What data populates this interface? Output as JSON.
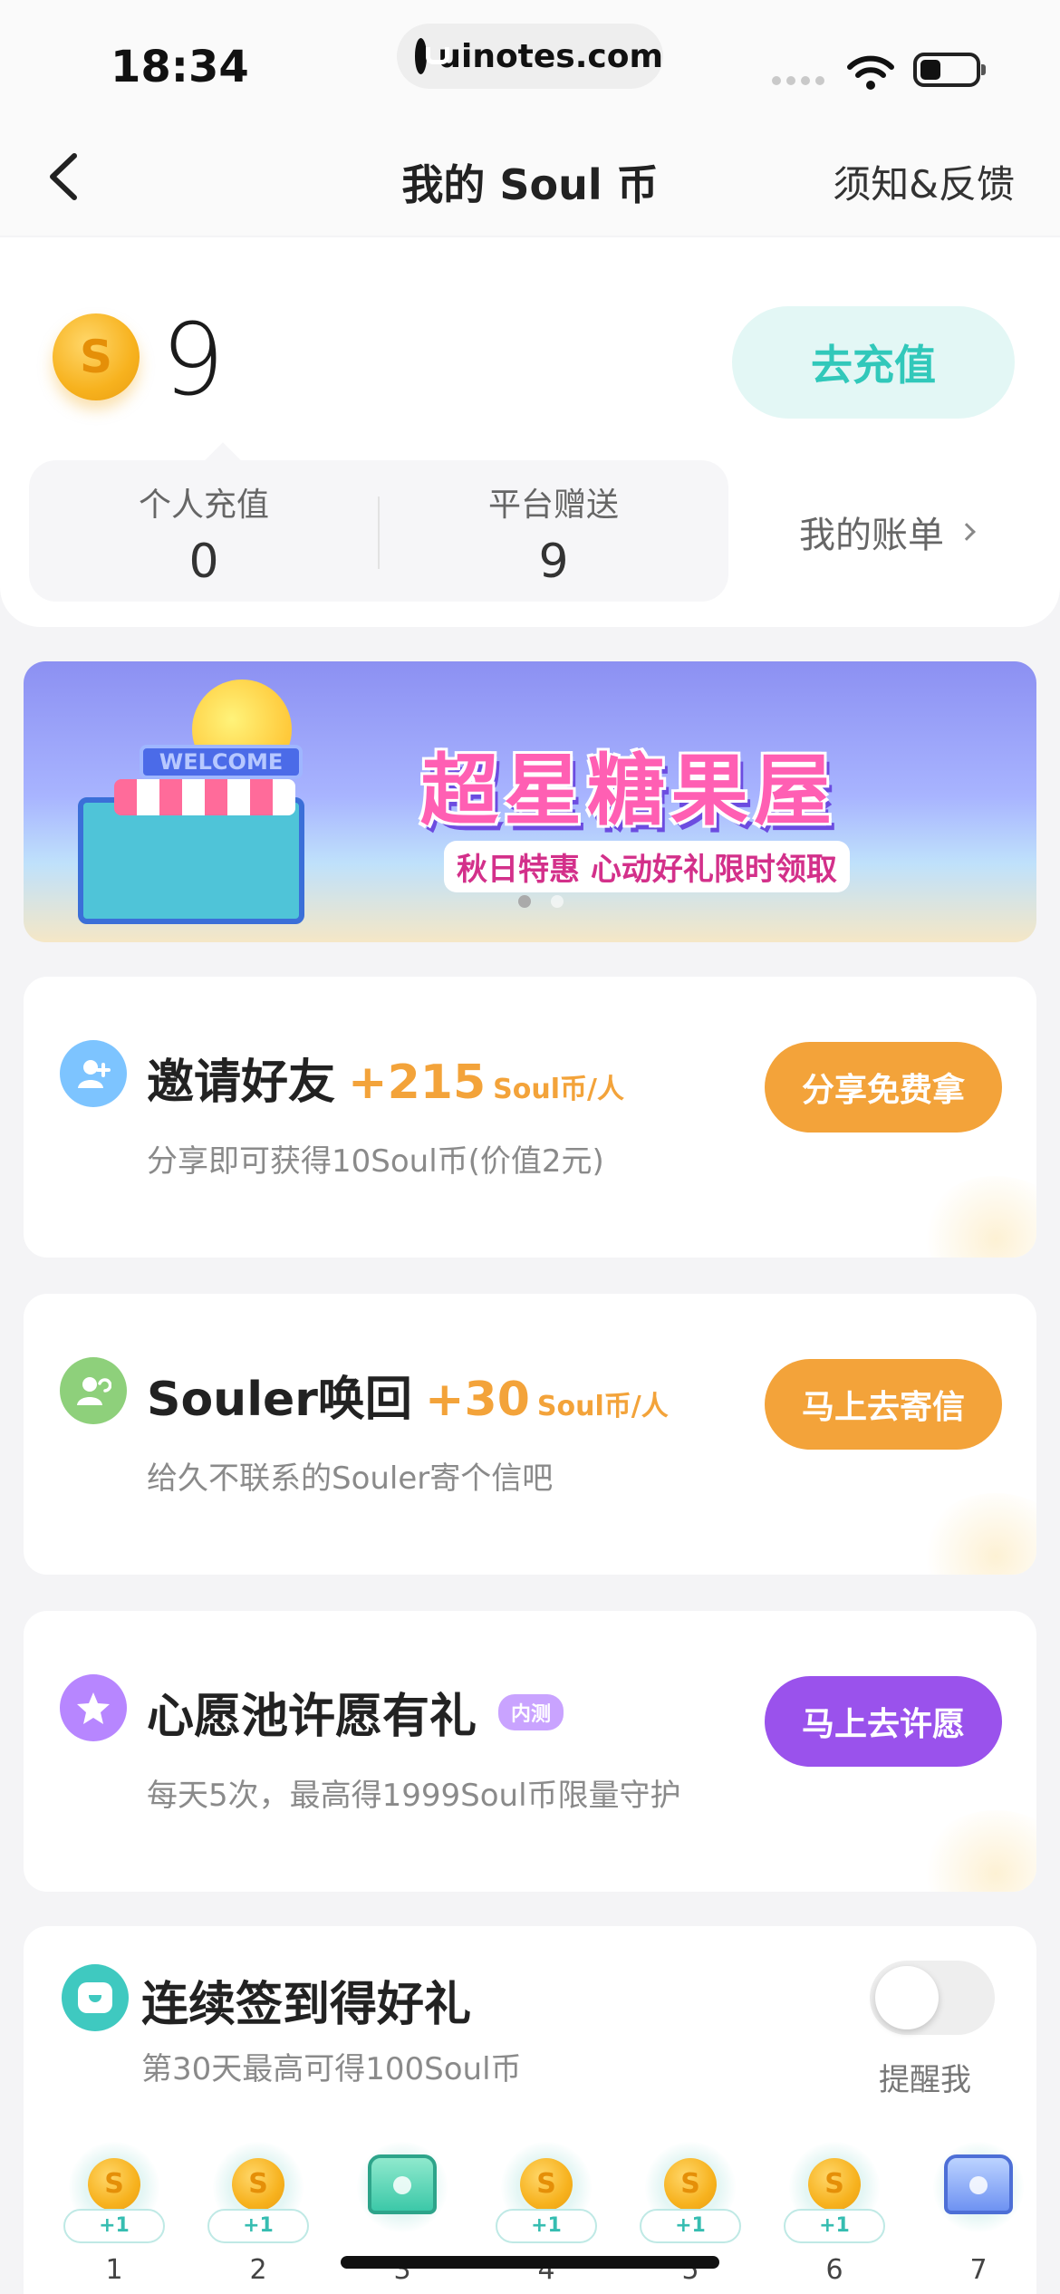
{
  "status_bar": {
    "time": "18:34",
    "url": "uinotes.com"
  },
  "nav": {
    "title": "我的 Soul 币",
    "right_label": "须知&反馈"
  },
  "balance": {
    "amount": "9",
    "recharge_label": "去充值",
    "personal_label": "个人充值",
    "personal_value": "0",
    "platform_label": "平台赠送",
    "platform_value": "9",
    "bill_label": "我的账单"
  },
  "banner": {
    "sign_text": "WELCOME",
    "title": "超星糖果屋",
    "subtitle": "秋日特惠 心动好礼限时领取"
  },
  "tasks": [
    {
      "title": "邀请好友",
      "plus": "+215",
      "unit": "Soul币/人",
      "badge": "",
      "desc": "分享即可获得10Soul币(价值2元)",
      "button": "分享免费拿",
      "icon": "add-user-icon"
    },
    {
      "title": "Souler唤回",
      "plus": "+30",
      "unit": "Soul币/人",
      "badge": "",
      "desc": "给久不联系的Souler寄个信吧",
      "button": "马上去寄信",
      "icon": "recall-user-icon"
    },
    {
      "title": "心愿池许愿有礼",
      "plus": "",
      "unit": "",
      "badge": "内测",
      "desc": "每天5次，最高得1999Soul币限量守护",
      "button": "马上去许愿",
      "icon": "star-icon"
    }
  ],
  "signin": {
    "title": "连续签到得好礼",
    "desc": "第30天最高可得100Soul币",
    "remind_label": "提醒我",
    "days": [
      {
        "num": "1",
        "reward": "+1",
        "type": "coin"
      },
      {
        "num": "2",
        "reward": "+1",
        "type": "coin"
      },
      {
        "num": "3",
        "reward": "",
        "type": "chest-teal"
      },
      {
        "num": "4",
        "reward": "+1",
        "type": "coin"
      },
      {
        "num": "5",
        "reward": "+1",
        "type": "coin"
      },
      {
        "num": "6",
        "reward": "+1",
        "type": "coin"
      },
      {
        "num": "7",
        "reward": "",
        "type": "chest-blue"
      }
    ]
  },
  "colors": {
    "accent_teal": "#31c8ba",
    "accent_orange": "#f3a33a",
    "accent_purple": "#9a52ec"
  }
}
